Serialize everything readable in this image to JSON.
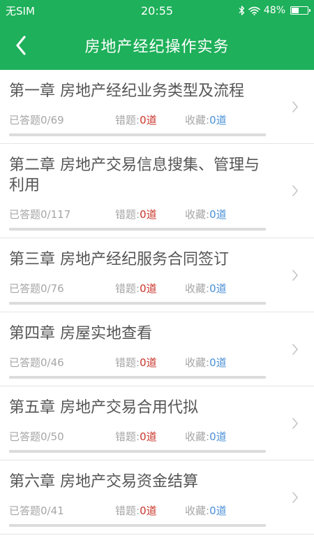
{
  "status_bar": {
    "carrier": "无SIM",
    "time": "20:55",
    "battery_percent": "48%",
    "battery_level": 0.48,
    "icons": [
      "bluetooth-icon",
      "wifi-icon",
      "battery-icon"
    ]
  },
  "header": {
    "back_icon": "chevron-left-icon",
    "title": "房地产经纪操作实务"
  },
  "labels": {
    "answered": "已答题",
    "wrong": "错题:",
    "favorites": "收藏:"
  },
  "chapters": [
    {
      "title": "第一章 房地产经纪业务类型及流程",
      "answered": "0/69",
      "wrong": "0道",
      "favorites": "0道",
      "progress": 0
    },
    {
      "title": "第二章 房地产交易信息搜集、管理与利用",
      "answered": "0/117",
      "wrong": "0道",
      "favorites": "0道",
      "progress": 0
    },
    {
      "title": "第三章 房地产经纪服务合同签订",
      "answered": "0/76",
      "wrong": "0道",
      "favorites": "0道",
      "progress": 0
    },
    {
      "title": "第四章 房屋实地查看",
      "answered": "0/46",
      "wrong": "0道",
      "favorites": "0道",
      "progress": 0
    },
    {
      "title": "第五章 房地产交易合用代拟",
      "answered": "0/50",
      "wrong": "0道",
      "favorites": "0道",
      "progress": 0
    },
    {
      "title": "第六章 房地产交易资金结算",
      "answered": "0/41",
      "wrong": "0道",
      "favorites": "0道",
      "progress": 0
    }
  ],
  "colors": {
    "brand_green": "#1eb05a",
    "wrong_red": "#c8352b",
    "favorites_blue": "#4a8fd6",
    "muted_text": "#a6a6a6"
  }
}
